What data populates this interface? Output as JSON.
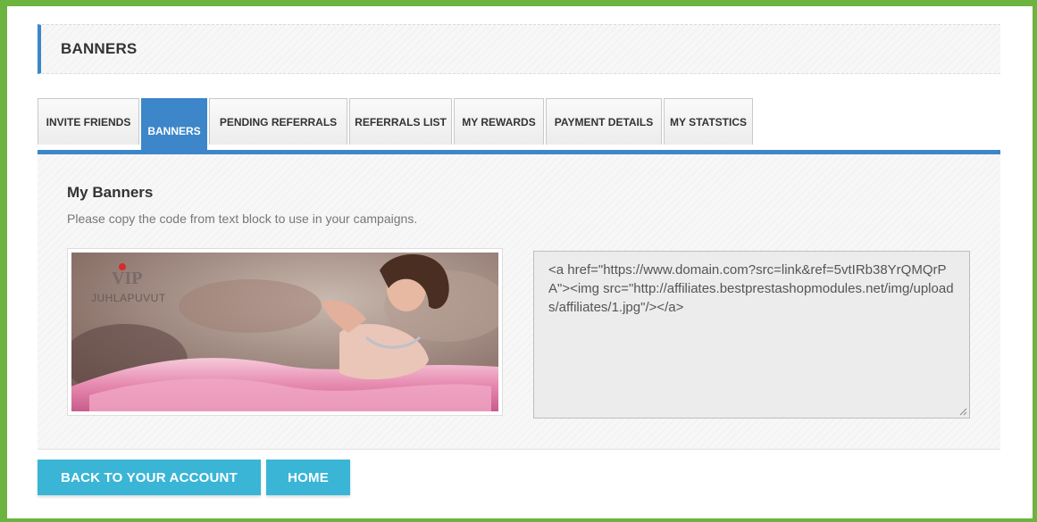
{
  "page": {
    "title": "BANNERS"
  },
  "tabs": [
    {
      "label": "INVITE FRIENDS",
      "active": false
    },
    {
      "label": "BANNERS",
      "active": true
    },
    {
      "label": "PENDING REFERRALS",
      "active": false
    },
    {
      "label": "REFERRALS LIST",
      "active": false
    },
    {
      "label": "MY REWARDS",
      "active": false
    },
    {
      "label": "PAYMENT DETAILS",
      "active": false
    },
    {
      "label": "MY STATSTICS",
      "active": false
    }
  ],
  "section": {
    "title": "My Banners",
    "description": "Please copy the code from text block to use in your campaigns."
  },
  "banner": {
    "logo_top": "VIP",
    "logo_bottom": "JUHLAPUVUT"
  },
  "code": {
    "value": "<a href=\"https://www.domain.com?src=link&ref=5vtIRb38YrQMQrPA\"><img src=\"http://affiliates.bestprestashopmodules.net/img/uploads/affiliates/1.jpg\"/></a>"
  },
  "buttons": {
    "back": "BACK TO YOUR ACCOUNT",
    "home": "HOME"
  },
  "colors": {
    "frame_green": "#6db33f",
    "accent_blue": "#3c86c9",
    "button_cyan": "#3ab5d6"
  }
}
